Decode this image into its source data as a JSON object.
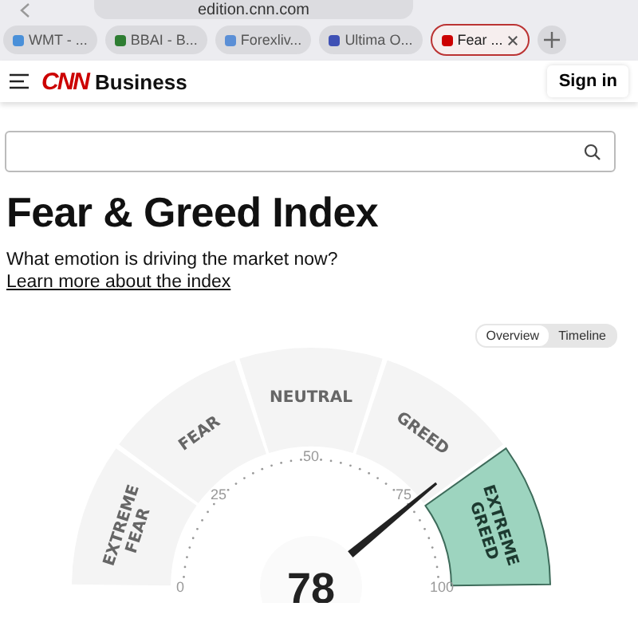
{
  "browser": {
    "url": "edition.cnn.com",
    "tabs": [
      {
        "label": "WMT - ...",
        "selected": false,
        "color": "#4a90d9"
      },
      {
        "label": "BBAI - B...",
        "selected": false,
        "color": "#2e7d32"
      },
      {
        "label": "Forexliv...",
        "selected": false,
        "color": "#5b8fd6"
      },
      {
        "label": "Ultima O...",
        "selected": false,
        "color": "#3f51b5"
      },
      {
        "label": "Fear ...",
        "selected": true,
        "color": "#cc0000"
      }
    ]
  },
  "header": {
    "logo": "CNN",
    "section": "Business",
    "sign_in": "Sign in"
  },
  "title": "Fear & Greed Index",
  "subtitle": "What emotion is driving the market now?",
  "link": "Learn more about the index",
  "views": [
    {
      "label": "Overview",
      "selected": true
    },
    {
      "label": "Timeline",
      "selected": false
    }
  ],
  "gauge": {
    "value": "78",
    "segments": [
      {
        "lines": [
          "EXTREME",
          "FEAR"
        ],
        "selected": false
      },
      {
        "lines": [
          "FEAR"
        ],
        "selected": false
      },
      {
        "lines": [
          "NEUTRAL"
        ],
        "selected": false
      },
      {
        "lines": [
          "GREED"
        ],
        "selected": false
      },
      {
        "lines": [
          "EXTREME",
          "GREED"
        ],
        "selected": true
      }
    ],
    "scale": [
      "0",
      "25",
      "50",
      "75",
      "100"
    ]
  }
}
